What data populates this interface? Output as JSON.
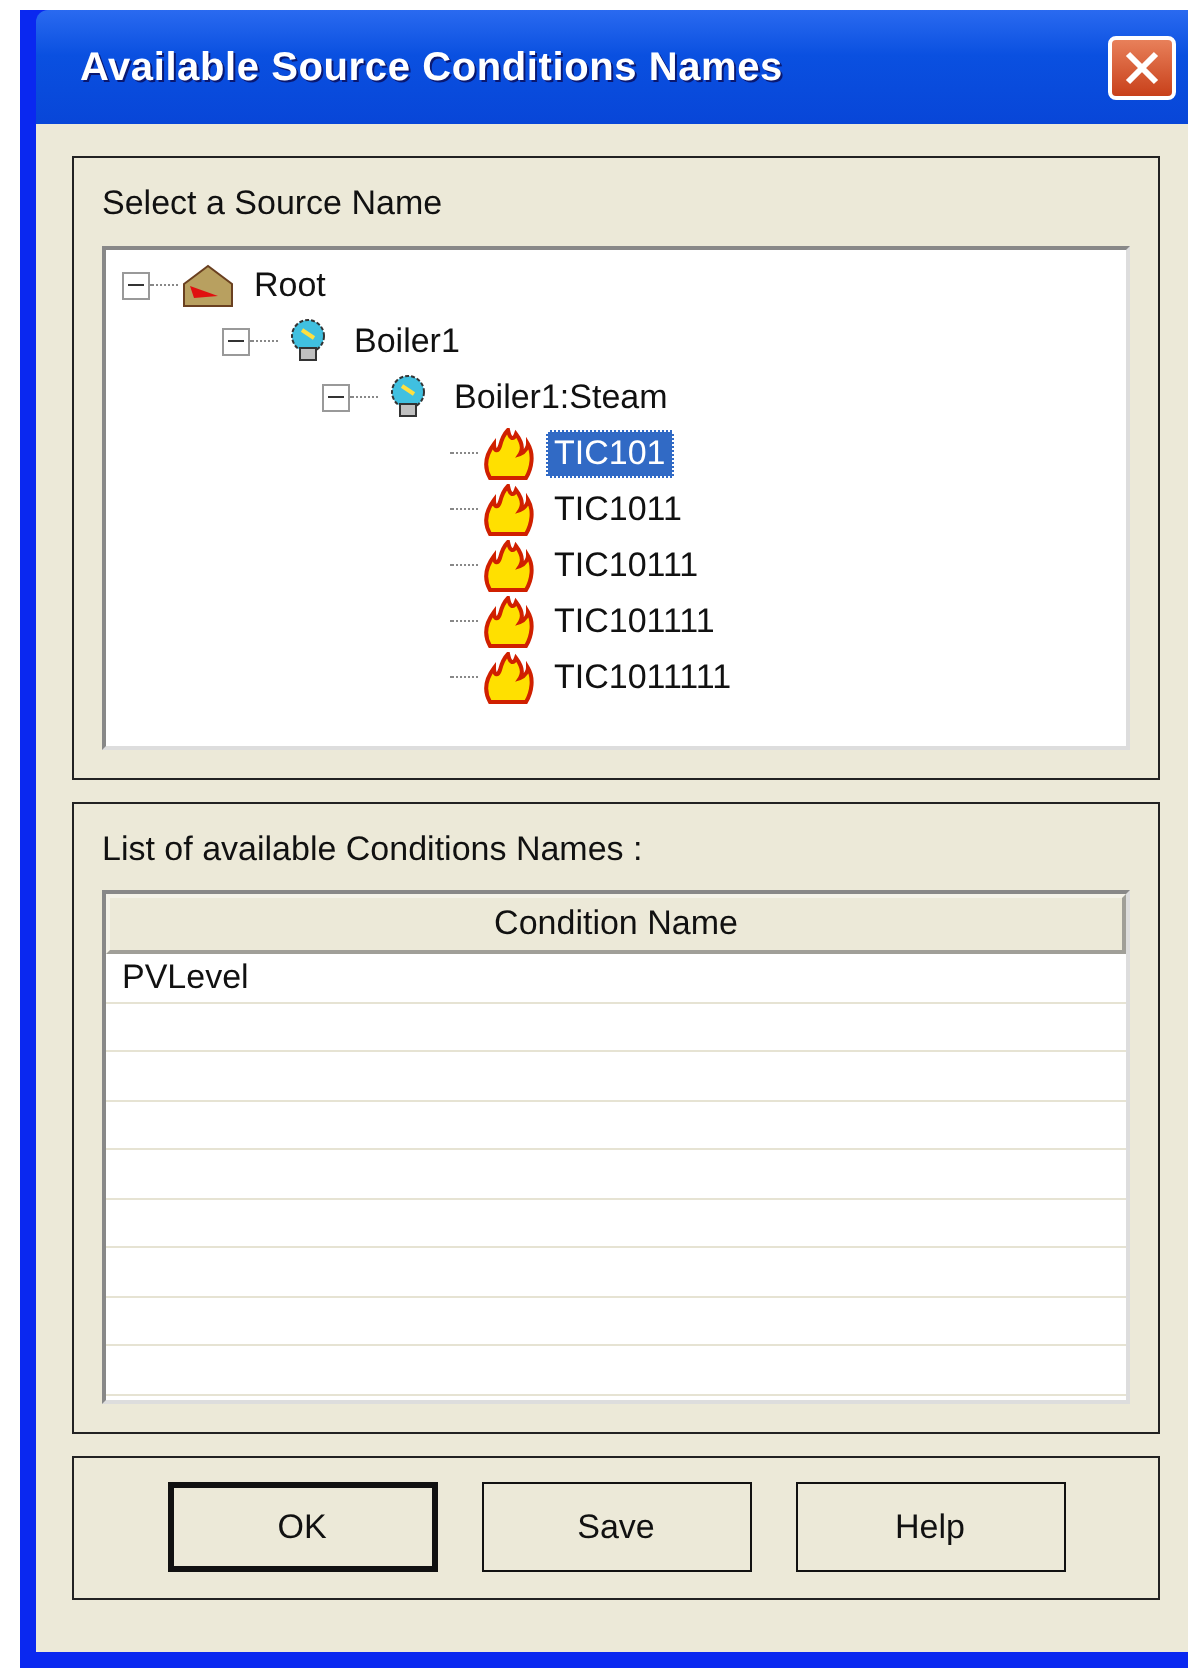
{
  "window": {
    "title": "Available Source Conditions Names"
  },
  "source_panel": {
    "label": "Select a Source Name",
    "tree": [
      {
        "label": "Root",
        "kind": "root",
        "expanded": true,
        "selected": false,
        "children": [
          {
            "label": "Boiler1",
            "kind": "bulb",
            "expanded": true,
            "selected": false,
            "children": [
              {
                "label": "Boiler1:Steam",
                "kind": "bulb",
                "expanded": true,
                "selected": false,
                "children": [
                  {
                    "label": "TIC101",
                    "kind": "flame",
                    "selected": true
                  },
                  {
                    "label": "TIC1011",
                    "kind": "flame",
                    "selected": false
                  },
                  {
                    "label": "TIC10111",
                    "kind": "flame",
                    "selected": false
                  },
                  {
                    "label": "TIC101111",
                    "kind": "flame",
                    "selected": false
                  },
                  {
                    "label": "TIC1011111",
                    "kind": "flame",
                    "selected": false
                  }
                ]
              }
            ]
          }
        ]
      }
    ]
  },
  "conditions_panel": {
    "label": "List of available Conditions Names :",
    "table": {
      "columns": [
        "Condition Name"
      ],
      "rows": [
        [
          "PVLevel"
        ]
      ]
    }
  },
  "buttons": [
    {
      "label": "OK",
      "default": true
    },
    {
      "label": "Save",
      "default": false
    },
    {
      "label": "Help",
      "default": false
    }
  ]
}
